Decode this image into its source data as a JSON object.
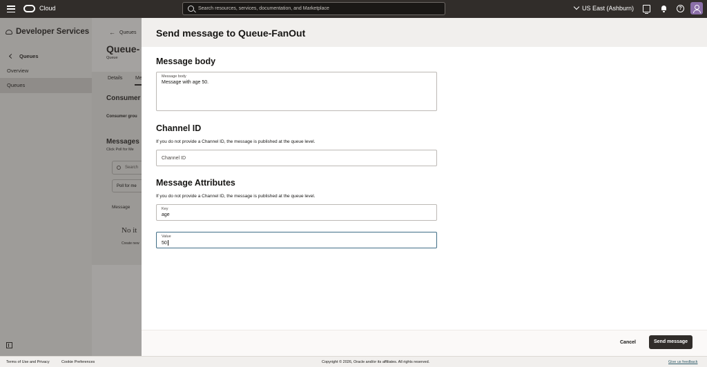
{
  "topbar": {
    "brand": "Cloud",
    "search_placeholder": "Search resources, services, documentation, and Marketplace",
    "region": "US East (Ashburn)"
  },
  "sidebar": {
    "title": "Developer Services",
    "back_label": "Queues",
    "items": [
      {
        "label": "Overview"
      },
      {
        "label": "Queues"
      }
    ]
  },
  "background_page": {
    "back_label": "Queues",
    "title": "Queue-",
    "subtitle": "Queue",
    "tabs": [
      "Details",
      "Me"
    ],
    "consumer_heading": "Consumer",
    "consumer_group_label": "Consumer grou",
    "messages_heading": "Messages",
    "messages_help": "Click Poll for Me",
    "search_placeholder": "Search",
    "poll_button": "Poll for me",
    "message_col": "Message",
    "empty_title": "No it",
    "empty_sub": "Create new"
  },
  "drawer": {
    "title": "Send message to Queue-FanOut",
    "message_body": {
      "heading": "Message body",
      "field_label": "Message body",
      "value": "Message with age 50."
    },
    "channel_id": {
      "heading": "Channel ID",
      "help": "If you do not provide a Channel ID, the message is published at the queue level.",
      "placeholder": "Channel ID"
    },
    "attributes": {
      "heading": "Message Attributes",
      "help": "If you do not provide a Channel ID, the message is published at the queue level.",
      "key_label": "Key",
      "key_value": "age",
      "value_label": "Value",
      "value_value": "50"
    },
    "cancel_label": "Cancel",
    "send_label": "Send message"
  },
  "footer": {
    "terms": "Terms of Use and Privacy",
    "cookie": "Cookie Preferences",
    "copyright": "Copyright © 2026, Oracle and/or its affiliates. All rights reserved.",
    "feedback": "Give us feedback"
  }
}
